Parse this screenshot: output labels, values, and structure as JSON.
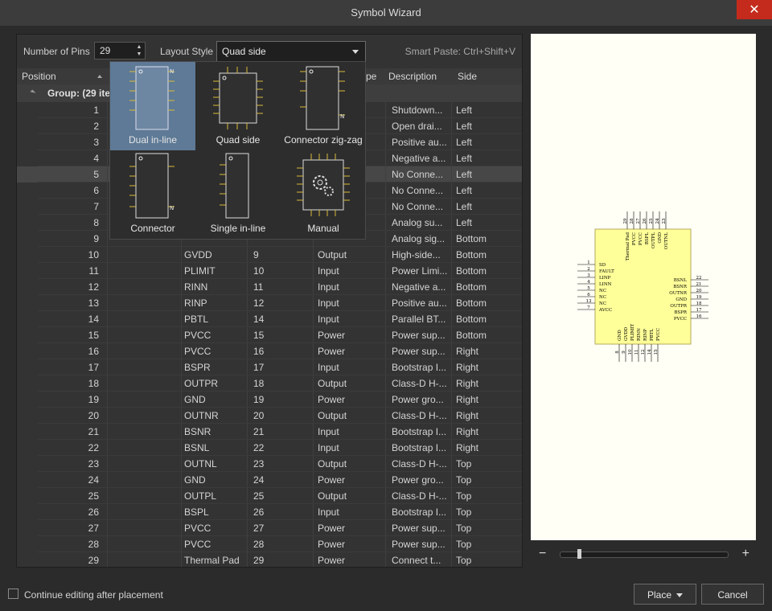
{
  "window": {
    "title": "Symbol Wizard",
    "close_glyph": "✕"
  },
  "toolbar": {
    "num_pins_label": "Number of Pins",
    "num_pins_value": "29",
    "layout_style_label": "Layout Style",
    "layout_style_value": "Quad side",
    "smart_paste": "Smart Paste: Ctrl+Shift+V"
  },
  "table": {
    "headers": {
      "position": "Position",
      "type": "pe",
      "description": "Description",
      "side": "Side"
    },
    "group_label": "Group:  (29 ite",
    "rows": [
      {
        "pos": "1",
        "name": "",
        "num": "",
        "type": "",
        "desc": "Shutdown...",
        "side": "Left"
      },
      {
        "pos": "2",
        "name": "",
        "num": "",
        "type": "",
        "desc": "Open drai...",
        "side": "Left"
      },
      {
        "pos": "3",
        "name": "",
        "num": "",
        "type": "",
        "desc": "Positive au...",
        "side": "Left"
      },
      {
        "pos": "4",
        "name": "",
        "num": "",
        "type": "",
        "desc": "Negative a...",
        "side": "Left"
      },
      {
        "pos": "5",
        "name": "",
        "num": "",
        "type": "",
        "desc": "No Conne...",
        "side": "Left"
      },
      {
        "pos": "6",
        "name": "",
        "num": "",
        "type": "",
        "desc": "No Conne...",
        "side": "Left"
      },
      {
        "pos": "7",
        "name": "",
        "num": "",
        "type": "",
        "desc": "No Conne...",
        "side": "Left"
      },
      {
        "pos": "8",
        "name": "",
        "num": "",
        "type": "",
        "desc": "Analog su...",
        "side": "Left"
      },
      {
        "pos": "9",
        "name": "",
        "num": "",
        "type": "",
        "desc": "Analog sig...",
        "side": "Bottom"
      },
      {
        "pos": "10",
        "name": "GVDD",
        "num": "9",
        "type": "Output",
        "desc": "High-side...",
        "side": "Bottom"
      },
      {
        "pos": "11",
        "name": "PLIMIT",
        "num": "10",
        "type": "Input",
        "desc": "Power Limi...",
        "side": "Bottom"
      },
      {
        "pos": "12",
        "name": "RINN",
        "num": "11",
        "type": "Input",
        "desc": "Negative a...",
        "side": "Bottom"
      },
      {
        "pos": "13",
        "name": "RINP",
        "num": "12",
        "type": "Input",
        "desc": "Positive au...",
        "side": "Bottom"
      },
      {
        "pos": "14",
        "name": "PBTL",
        "num": "14",
        "type": "Input",
        "desc": "Parallel BT...",
        "side": "Bottom"
      },
      {
        "pos": "15",
        "name": "PVCC",
        "num": "15",
        "type": "Power",
        "desc": "Power sup...",
        "side": "Bottom"
      },
      {
        "pos": "16",
        "name": "PVCC",
        "num": "16",
        "type": "Power",
        "desc": "Power sup...",
        "side": "Right"
      },
      {
        "pos": "17",
        "name": "BSPR",
        "num": "17",
        "type": "Input",
        "desc": "Bootstrap I...",
        "side": "Right"
      },
      {
        "pos": "18",
        "name": "OUTPR",
        "num": "18",
        "type": "Output",
        "desc": "Class-D H-...",
        "side": "Right"
      },
      {
        "pos": "19",
        "name": "GND",
        "num": "19",
        "type": "Power",
        "desc": "Power gro...",
        "side": "Right"
      },
      {
        "pos": "20",
        "name": "OUTNR",
        "num": "20",
        "type": "Output",
        "desc": "Class-D H-...",
        "side": "Right"
      },
      {
        "pos": "21",
        "name": "BSNR",
        "num": "21",
        "type": "Input",
        "desc": "Bootstrap I...",
        "side": "Right"
      },
      {
        "pos": "22",
        "name": "BSNL",
        "num": "22",
        "type": "Input",
        "desc": "Bootstrap I...",
        "side": "Right"
      },
      {
        "pos": "23",
        "name": "OUTNL",
        "num": "23",
        "type": "Output",
        "desc": "Class-D H-...",
        "side": "Top"
      },
      {
        "pos": "24",
        "name": "GND",
        "num": "24",
        "type": "Power",
        "desc": "Power gro...",
        "side": "Top"
      },
      {
        "pos": "25",
        "name": "OUTPL",
        "num": "25",
        "type": "Output",
        "desc": "Class-D H-...",
        "side": "Top"
      },
      {
        "pos": "26",
        "name": "BSPL",
        "num": "26",
        "type": "Input",
        "desc": "Bootstrap I...",
        "side": "Top"
      },
      {
        "pos": "27",
        "name": "PVCC",
        "num": "27",
        "type": "Power",
        "desc": "Power sup...",
        "side": "Top"
      },
      {
        "pos": "28",
        "name": "PVCC",
        "num": "28",
        "type": "Power",
        "desc": "Power sup...",
        "side": "Top"
      },
      {
        "pos": "29",
        "name": "Thermal Pad",
        "num": "29",
        "type": "Power",
        "desc": "Connect t...",
        "side": "Top"
      }
    ]
  },
  "layout_popup": {
    "tiles": [
      {
        "label": "Dual in-line",
        "icon": "dual-in-line-icon"
      },
      {
        "label": "Quad side",
        "icon": "quad-side-icon"
      },
      {
        "label": "Connector zig-zag",
        "icon": "connector-zigzag-icon"
      },
      {
        "label": "Connector",
        "icon": "connector-icon"
      },
      {
        "label": "Single in-line",
        "icon": "single-in-line-icon"
      },
      {
        "label": "Manual",
        "icon": "gear-icon"
      }
    ]
  },
  "preview": {
    "left_pins": [
      [
        "1",
        "SD"
      ],
      [
        "2",
        "FAULT"
      ],
      [
        "3",
        "LINP"
      ],
      [
        "4",
        "LINN"
      ],
      [
        "5",
        "NC"
      ],
      [
        "6",
        "NC"
      ],
      [
        "13",
        "NC"
      ],
      [
        "7",
        "AVCC"
      ]
    ],
    "right_pins": [
      [
        "22",
        "BSNL"
      ],
      [
        "21",
        "BSNR"
      ],
      [
        "20",
        "OUTNR"
      ],
      [
        "19",
        "GND"
      ],
      [
        "18",
        "OUTPR"
      ],
      [
        "17",
        "BSPR"
      ],
      [
        "16",
        "PVCC"
      ]
    ],
    "top_pins": [
      [
        "29",
        "Thermal Pad"
      ],
      [
        "28",
        "PVCC"
      ],
      [
        "27",
        "PVCC"
      ],
      [
        "26",
        "BSPL"
      ],
      [
        "25",
        "OUTPL"
      ],
      [
        "24",
        "GND"
      ],
      [
        "23",
        "OUTNL"
      ]
    ],
    "bottom_pins": [
      [
        "8",
        "GND"
      ],
      [
        "9",
        "GVDD"
      ],
      [
        "10",
        "PLIMIT"
      ],
      [
        "11",
        "RINN"
      ],
      [
        "12",
        "RINP"
      ],
      [
        "14",
        "PBTL"
      ],
      [
        "15",
        "PVCC"
      ]
    ],
    "zoom_minus": "−",
    "zoom_plus": "+"
  },
  "footer": {
    "continue_label": "Continue editing after placement",
    "place_label": "Place",
    "cancel_label": "Cancel"
  },
  "colors": {
    "accent_tile": "#5e7a96",
    "close": "#c42b1c",
    "preview_bg": "#fffff6",
    "symbol_body": "#ffff99"
  }
}
